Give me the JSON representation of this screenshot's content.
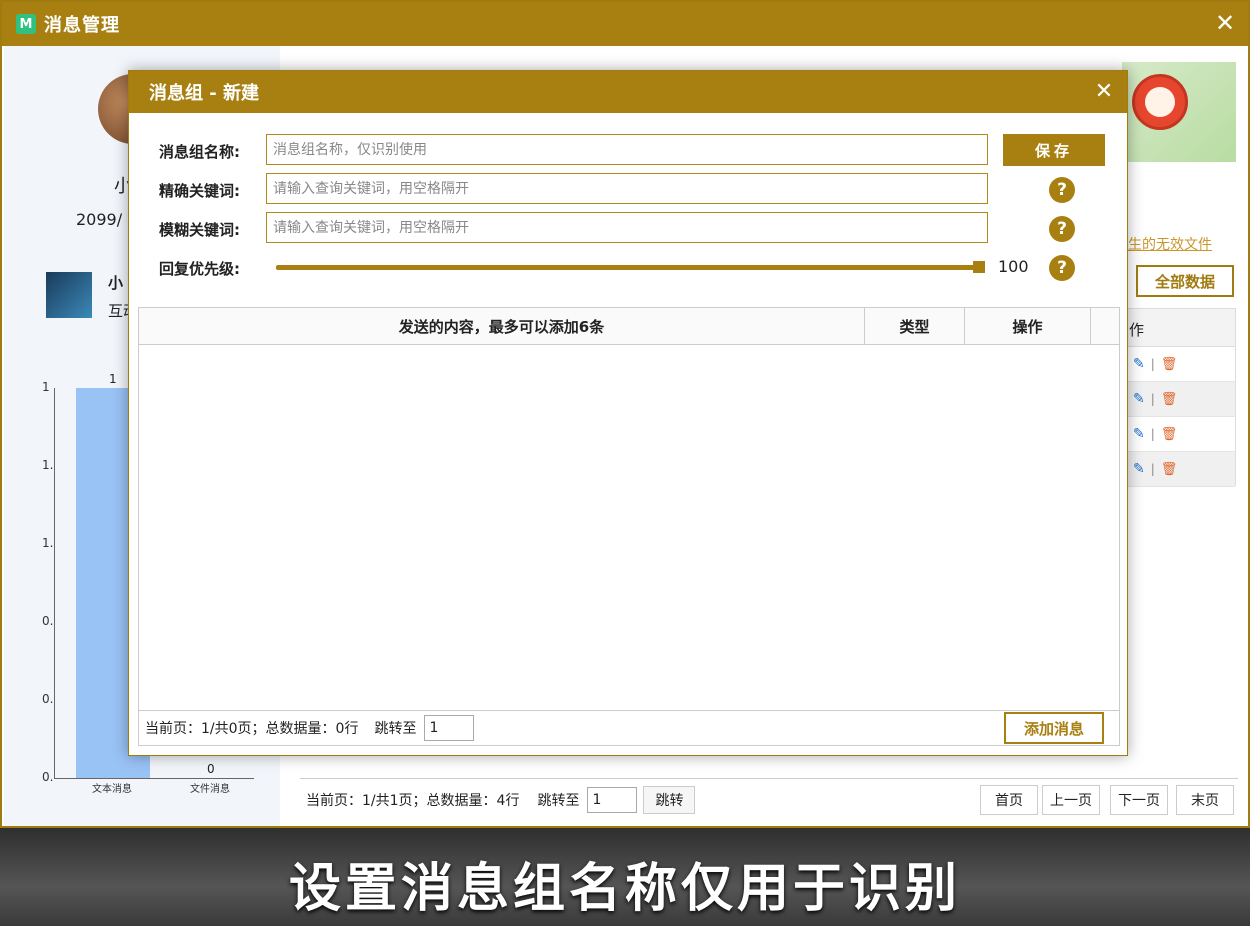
{
  "window": {
    "app_icon": "M",
    "title": "消息管理",
    "close": "✕"
  },
  "background": {
    "user_name": "小",
    "user_date": "2099/",
    "contact_name": "小",
    "contact_sub": "互动",
    "chart_data": {
      "type": "bar",
      "categories": [
        "文本消息",
        "文件消息"
      ],
      "values": [
        1,
        0
      ],
      "data_labels": [
        "1",
        "0"
      ],
      "y_ticks": [
        "1",
        "1.",
        "1.",
        "0.",
        "0.",
        "0."
      ]
    },
    "invalid_link": "生的无效文件",
    "all_data_button": "全部数据",
    "table_header_ops": "作",
    "row_icons": {
      "edit": "✎",
      "sep": "|",
      "delete": "🗑"
    },
    "pager": {
      "info": "当前页：1/共1页；总数据量：4行",
      "jump_label": "跳转至",
      "jump_value": "1",
      "jump_button": "跳转",
      "first": "首页",
      "prev": "上一页",
      "next": "下一页",
      "last": "末页"
    }
  },
  "dialog": {
    "title": "消息组 - 新建",
    "close": "✕",
    "name_label": "消息组名称:",
    "name_placeholder": "消息组名称，仅识别使用",
    "exact_label": "精确关键词:",
    "exact_placeholder": "请输入查询关键词，用空格隔开",
    "fuzzy_label": "模糊关键词:",
    "fuzzy_placeholder": "请输入查询关键词，用空格隔开",
    "priority_label": "回复优先级:",
    "priority_value": "100",
    "priority_level": 1.0,
    "save_button": "保存",
    "help_mark": "?",
    "table": {
      "col_content": "发送的内容，最多可以添加6条",
      "col_type": "类型",
      "col_ops": "操作"
    },
    "pager": {
      "info": "当前页：1/共0页；总数据量：0行",
      "jump_label": "跳转至",
      "jump_value": "1"
    },
    "add_button": "添加消息"
  },
  "subtitle": "设置消息组名称仅用于识别",
  "colors": {
    "accent": "#a88012",
    "bar": "#99c2f5",
    "delete": "#e0662a",
    "edit": "#1a6fd0"
  }
}
